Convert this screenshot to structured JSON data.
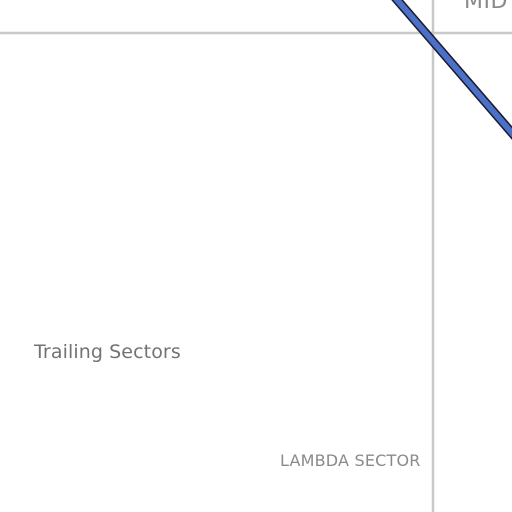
{
  "map": {
    "labels": {
      "district": "Trailing Sectors",
      "sector": "LAMBDA SECTOR",
      "partial_top_right": "MID"
    },
    "colors": {
      "background": "#ffffff",
      "grid_line": "#c8c8c8",
      "route_fill": "#4a70c8",
      "route_outline": "#1a1a2e",
      "label_text": "#7a7a7a"
    }
  }
}
